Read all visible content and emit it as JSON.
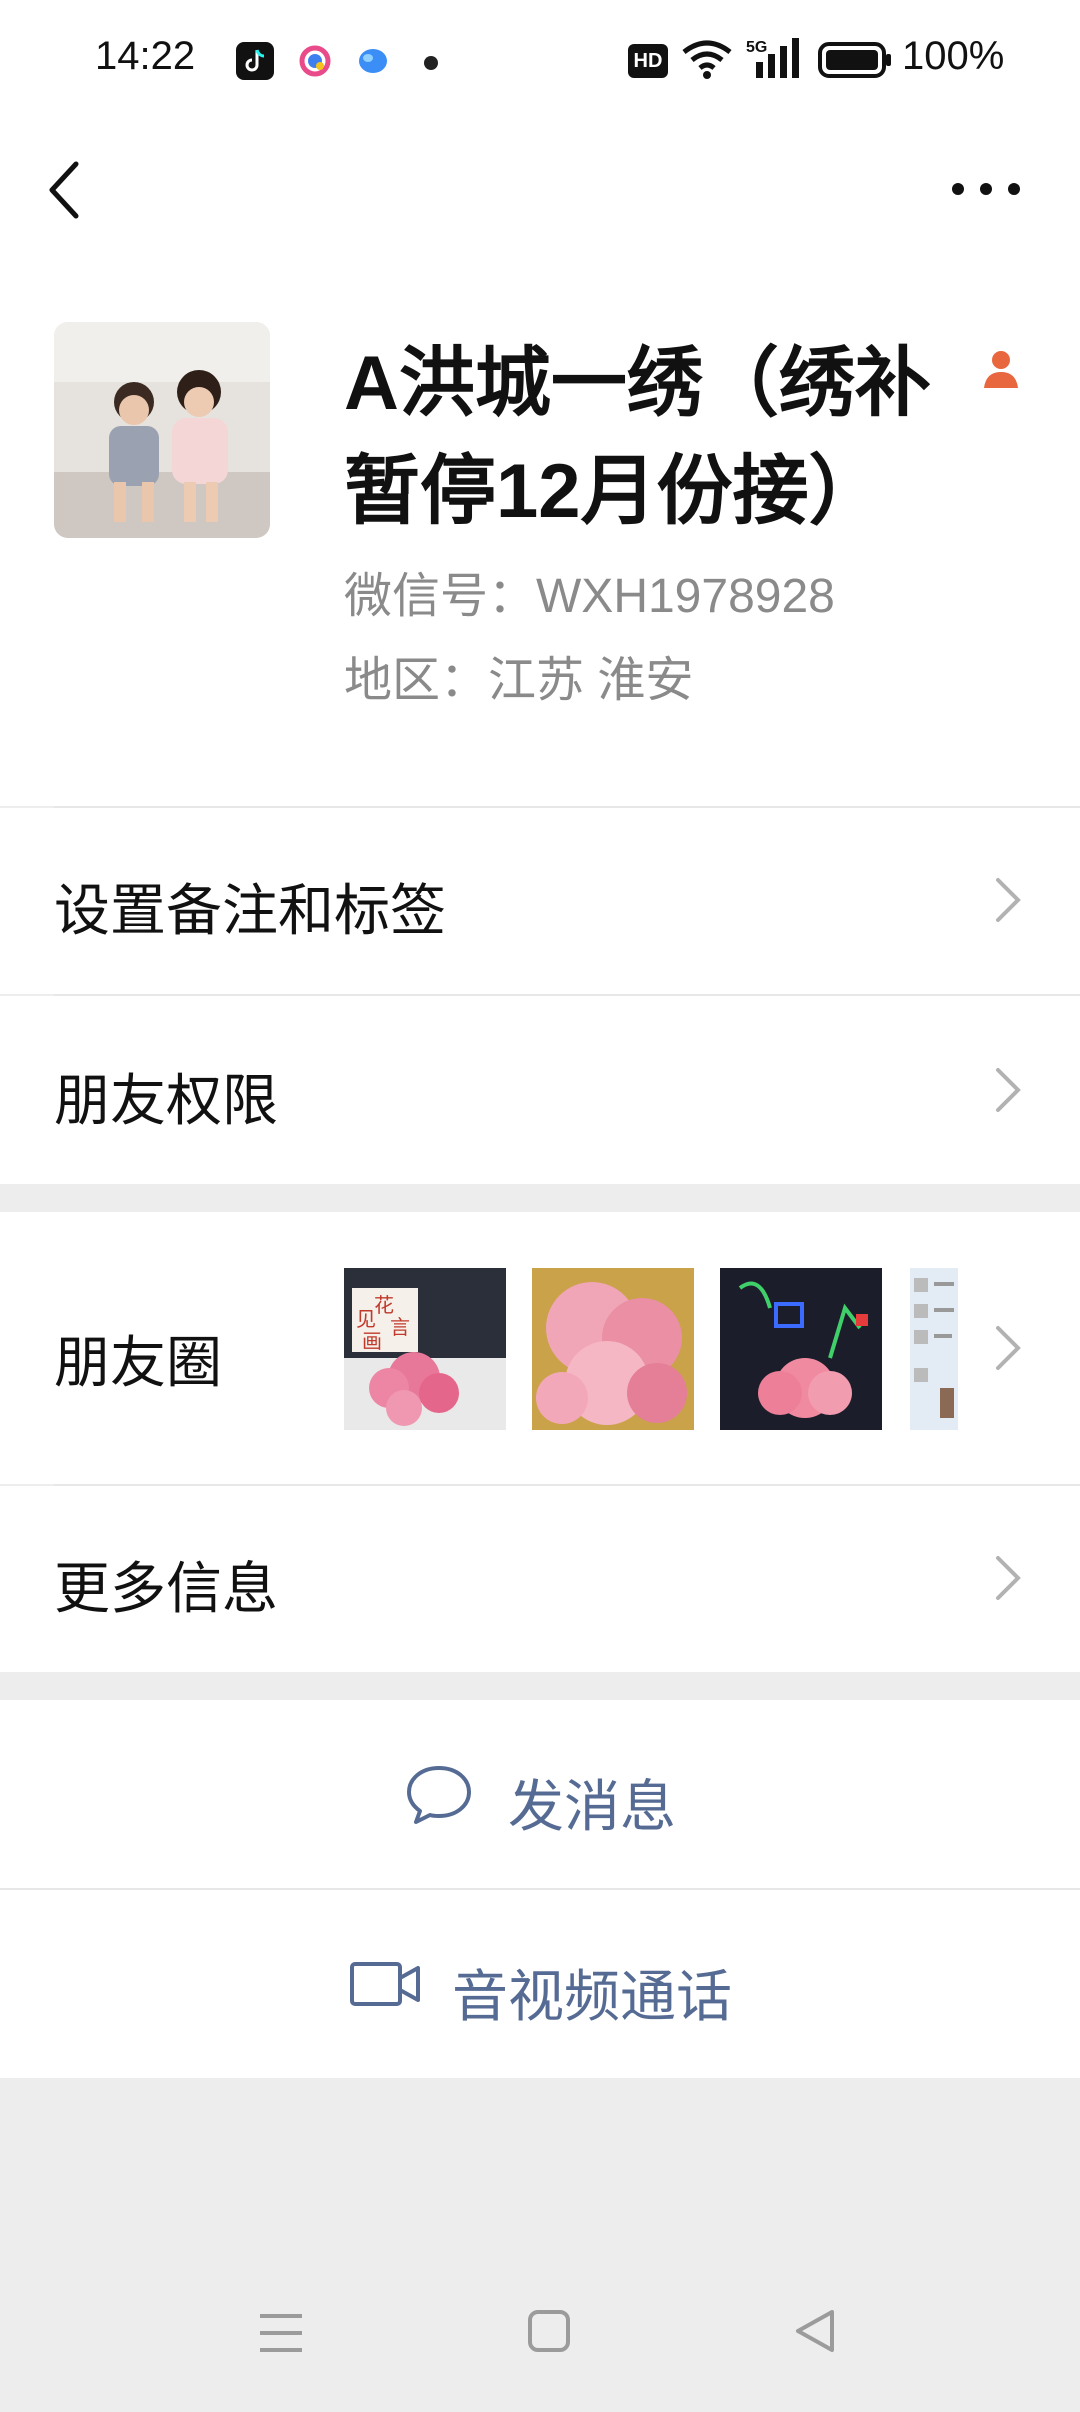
{
  "status_bar": {
    "time": "14:22",
    "battery": "100%",
    "network": "5G",
    "hd": "HD",
    "icons": [
      "tiktok-icon",
      "app-colorful-icon",
      "app-blue-icon",
      "notification-dot",
      "hd-icon",
      "wifi-icon",
      "signal-5g-icon",
      "battery-icon"
    ]
  },
  "nav": {
    "back_icon": "back-chevron-icon",
    "more_icon": "more-dots-icon"
  },
  "profile": {
    "name_line1": "A洪城一绣（绣补",
    "name_line2": "暂停12月份接）",
    "wechat_id": "微信号：WXH1978928",
    "region": "地区：江苏  淮安",
    "gender_icon": "female-person-icon"
  },
  "menu": {
    "remark": "设置备注和标签",
    "permission": "朋友权限",
    "moments": "朋友圈",
    "more_info": "更多信息"
  },
  "moments_thumbs": [
    {
      "caption": "花\n见\n言\n画",
      "desc": "pink carnation bouquet"
    },
    {
      "desc": "pink carnations close-up"
    },
    {
      "desc": "pink carnation on colorful screen"
    },
    {
      "desc": "partial screenshot"
    }
  ],
  "actions": {
    "message": "发消息",
    "call": "音视频通话"
  },
  "system_nav": [
    "menu-icon",
    "home-square-icon",
    "back-triangle-icon"
  ],
  "colors": {
    "accent": "#566b94",
    "gender": "#e8673e",
    "background": "#ededed"
  }
}
